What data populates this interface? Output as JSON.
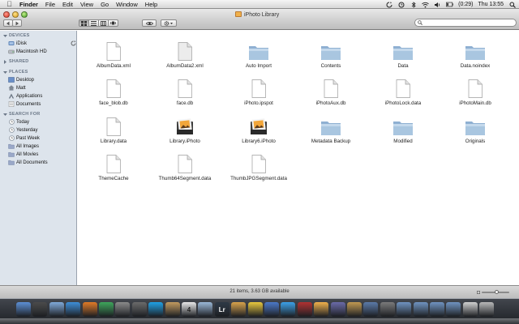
{
  "menubar": {
    "apple_icon": "apple-icon",
    "items": [
      "Finder",
      "File",
      "Edit",
      "View",
      "Go",
      "Window",
      "Help"
    ],
    "status": {
      "battery": "(0:29)",
      "clock": "Thu 13:55"
    }
  },
  "window": {
    "title": "iPhoto Library",
    "search_placeholder": ""
  },
  "sidebar": {
    "sections": [
      {
        "header": "DEVICES",
        "items": [
          "iDisk",
          "Macintosh HD"
        ]
      },
      {
        "header": "SHARED",
        "items": []
      },
      {
        "header": "PLACES",
        "items": [
          "Desktop",
          "Matt",
          "Applications",
          "Documents"
        ]
      },
      {
        "header": "SEARCH FOR",
        "items": [
          "Today",
          "Yesterday",
          "Past Week",
          "All Images",
          "All Movies",
          "All Documents"
        ]
      }
    ]
  },
  "files": [
    {
      "name": "AlbumData.xml",
      "icon": "document"
    },
    {
      "name": "AlbumData2.xml",
      "icon": "document-gray"
    },
    {
      "name": "Auto Import",
      "icon": "folder"
    },
    {
      "name": "Contents",
      "icon": "folder"
    },
    {
      "name": "Data",
      "icon": "folder"
    },
    {
      "name": "Data.noindex",
      "icon": "folder"
    },
    {
      "name": "face_blob.db",
      "icon": "document"
    },
    {
      "name": "face.db",
      "icon": "document"
    },
    {
      "name": "iPhoto.ipspot",
      "icon": "document"
    },
    {
      "name": "iPhotoAux.db",
      "icon": "document"
    },
    {
      "name": "iPhotoLock.data",
      "icon": "document"
    },
    {
      "name": "iPhotoMain.db",
      "icon": "document"
    },
    {
      "name": "Library.data",
      "icon": "document"
    },
    {
      "name": "Library.iPhoto",
      "icon": "iphoto"
    },
    {
      "name": "Library6.iPhoto",
      "icon": "iphoto"
    },
    {
      "name": "Metadata Backup",
      "icon": "folder"
    },
    {
      "name": "Modified",
      "icon": "folder"
    },
    {
      "name": "Originals",
      "icon": "folder"
    },
    {
      "name": "ThemeCache",
      "icon": "document"
    },
    {
      "name": "Thumb64Segment.data",
      "icon": "document"
    },
    {
      "name": "ThumbJPGSegment.data",
      "icon": "document"
    }
  ],
  "status": {
    "text": "21 items, 3.63 GB available",
    "zoom": 0.55
  },
  "colors": {
    "folder": "#a9c6e0",
    "sidebar": "#dde4ec",
    "sidebar_header": "#6b7787"
  },
  "dock": {
    "icons": [
      "finder-icon",
      "dashboard-icon",
      "mail-icon",
      "safari-icon",
      "firefox-icon",
      "chat-icon",
      "lock-icon",
      "webcam-icon",
      "skype-icon",
      "address-book-icon",
      "calendar-icon",
      "preview-icon",
      "lightroom-icon",
      "photo-icon",
      "chrome-icon",
      "brush-icon",
      "itunes-icon",
      "photo-booth-icon",
      "iphoto-icon",
      "imovie-icon",
      "garageband-icon",
      "time-machine-icon",
      "system-preferences-icon",
      "folder-icon",
      "folder-icon",
      "folder-icon",
      "folder-icon",
      "documents-icon",
      "trash-icon"
    ]
  }
}
